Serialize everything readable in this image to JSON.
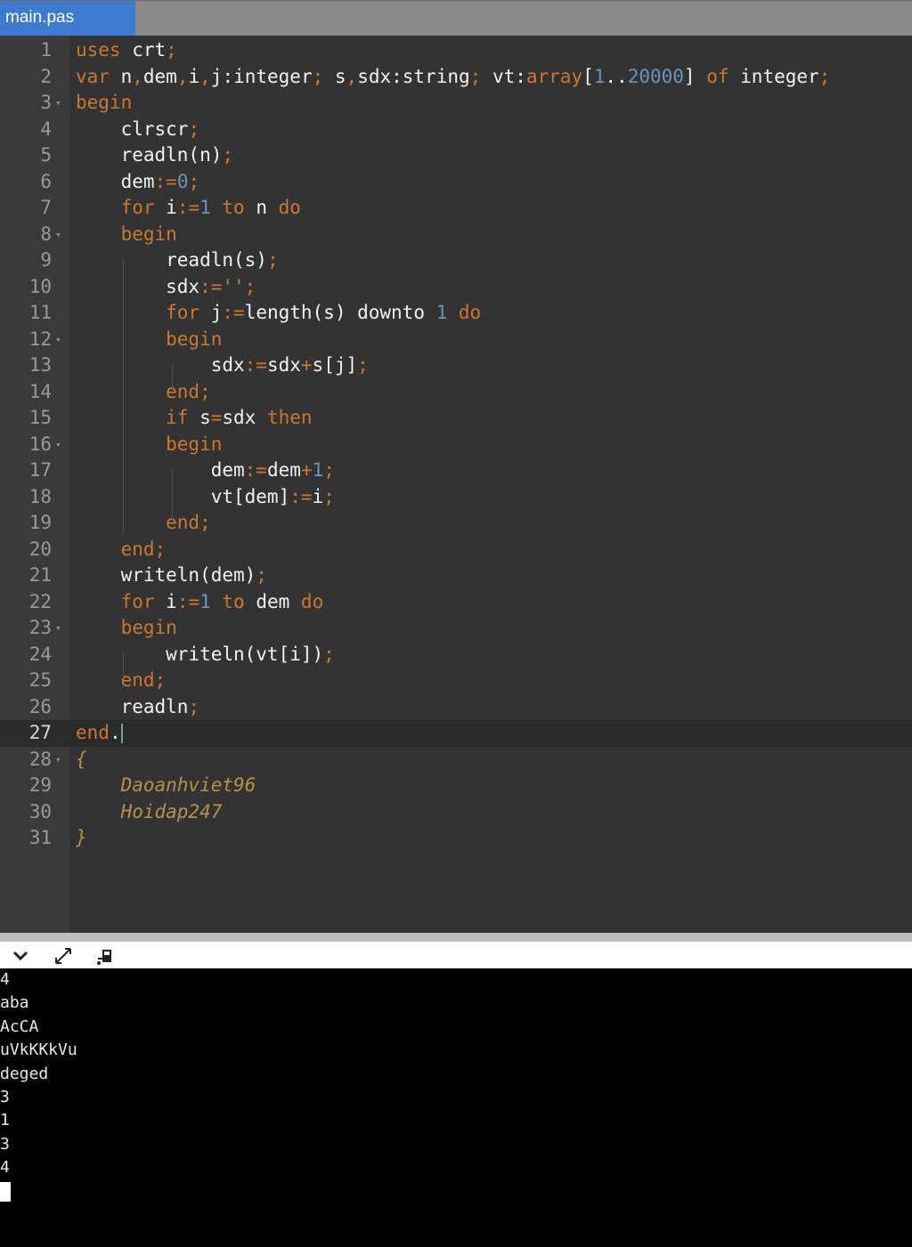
{
  "tab": {
    "title": "main.pas"
  },
  "editor": {
    "lines": [
      {
        "n": "1",
        "t": [
          [
            "k",
            "uses "
          ],
          [
            "",
            "crt"
          ],
          [
            "p",
            ";"
          ]
        ]
      },
      {
        "n": "2",
        "t": [
          [
            "k",
            "var "
          ],
          [
            "",
            "n"
          ],
          [
            "p",
            ","
          ],
          [
            "",
            "dem"
          ],
          [
            "p",
            ","
          ],
          [
            "",
            "i"
          ],
          [
            "p",
            ","
          ],
          [
            "",
            "j:integer"
          ],
          [
            "p",
            "; "
          ],
          [
            "",
            "s"
          ],
          [
            "p",
            ","
          ],
          [
            "",
            "sdx:string"
          ],
          [
            "p",
            "; "
          ],
          [
            "",
            "vt:"
          ],
          [
            "k",
            "array"
          ],
          [
            "",
            "["
          ],
          [
            "n",
            "1"
          ],
          [
            "",
            ".."
          ],
          [
            "n",
            "20000"
          ],
          [
            "",
            "] "
          ],
          [
            "k",
            "of "
          ],
          [
            "",
            "integer"
          ],
          [
            "p",
            ";"
          ]
        ]
      },
      {
        "n": "3",
        "fold": true,
        "t": [
          [
            "k",
            "begin"
          ]
        ]
      },
      {
        "n": "4",
        "t": [
          [
            "",
            "    clrscr"
          ],
          [
            "p",
            ";"
          ]
        ]
      },
      {
        "n": "5",
        "t": [
          [
            "",
            "    readln(n)"
          ],
          [
            "p",
            ";"
          ]
        ]
      },
      {
        "n": "6",
        "t": [
          [
            "",
            "    dem"
          ],
          [
            "p",
            ":="
          ],
          [
            "n",
            "0"
          ],
          [
            "p",
            ";"
          ]
        ]
      },
      {
        "n": "7",
        "t": [
          [
            "k",
            "    for "
          ],
          [
            "",
            "i"
          ],
          [
            "p",
            ":="
          ],
          [
            "n",
            "1"
          ],
          [
            "k",
            " to "
          ],
          [
            "",
            "n "
          ],
          [
            "k",
            "do"
          ]
        ]
      },
      {
        "n": "8",
        "fold": true,
        "t": [
          [
            "k",
            "    begin"
          ]
        ]
      },
      {
        "n": "9",
        "t": [
          [
            "",
            "        readln(s)"
          ],
          [
            "p",
            ";"
          ]
        ]
      },
      {
        "n": "10",
        "t": [
          [
            "",
            "        sdx"
          ],
          [
            "p",
            ":="
          ],
          [
            "s",
            "''"
          ],
          [
            "p",
            ";"
          ]
        ]
      },
      {
        "n": "11",
        "t": [
          [
            "k",
            "        for "
          ],
          [
            "",
            "j"
          ],
          [
            "p",
            ":="
          ],
          [
            "",
            "length(s) downto "
          ],
          [
            "n",
            "1"
          ],
          [
            "k",
            " do"
          ]
        ]
      },
      {
        "n": "12",
        "fold": true,
        "t": [
          [
            "k",
            "        begin"
          ]
        ]
      },
      {
        "n": "13",
        "t": [
          [
            "",
            "            sdx"
          ],
          [
            "p",
            ":="
          ],
          [
            "",
            "sdx"
          ],
          [
            "p",
            "+"
          ],
          [
            "",
            "s[j]"
          ],
          [
            "p",
            ";"
          ]
        ]
      },
      {
        "n": "14",
        "t": [
          [
            "k",
            "        end"
          ],
          [
            "p",
            ";"
          ]
        ]
      },
      {
        "n": "15",
        "t": [
          [
            "k",
            "        if "
          ],
          [
            "",
            "s"
          ],
          [
            "p",
            "="
          ],
          [
            "",
            "sdx "
          ],
          [
            "k",
            "then"
          ]
        ]
      },
      {
        "n": "16",
        "fold": true,
        "t": [
          [
            "k",
            "        begin"
          ]
        ]
      },
      {
        "n": "17",
        "t": [
          [
            "",
            "            dem"
          ],
          [
            "p",
            ":="
          ],
          [
            "",
            "dem"
          ],
          [
            "p",
            "+"
          ],
          [
            "n",
            "1"
          ],
          [
            "p",
            ";"
          ]
        ]
      },
      {
        "n": "18",
        "t": [
          [
            "",
            "            vt[dem]"
          ],
          [
            "p",
            ":="
          ],
          [
            "",
            "i"
          ],
          [
            "p",
            ";"
          ]
        ]
      },
      {
        "n": "19",
        "t": [
          [
            "k",
            "        end"
          ],
          [
            "p",
            ";"
          ]
        ]
      },
      {
        "n": "20",
        "t": [
          [
            "k",
            "    end"
          ],
          [
            "p",
            ";"
          ]
        ]
      },
      {
        "n": "21",
        "t": [
          [
            "",
            "    writeln(dem)"
          ],
          [
            "p",
            ";"
          ]
        ]
      },
      {
        "n": "22",
        "t": [
          [
            "k",
            "    for "
          ],
          [
            "",
            "i"
          ],
          [
            "p",
            ":="
          ],
          [
            "n",
            "1"
          ],
          [
            "k",
            " to "
          ],
          [
            "",
            "dem "
          ],
          [
            "k",
            "do"
          ]
        ]
      },
      {
        "n": "23",
        "fold": true,
        "t": [
          [
            "k",
            "    begin"
          ]
        ]
      },
      {
        "n": "24",
        "t": [
          [
            "",
            "        writeln(vt[i])"
          ],
          [
            "p",
            ";"
          ]
        ]
      },
      {
        "n": "25",
        "t": [
          [
            "k",
            "    end"
          ],
          [
            "p",
            ";"
          ]
        ]
      },
      {
        "n": "26",
        "t": [
          [
            "",
            "    readln"
          ],
          [
            "p",
            ";"
          ]
        ]
      },
      {
        "n": "27",
        "active": true,
        "caret": true,
        "t": [
          [
            "k",
            "end"
          ],
          [
            "",
            "."
          ]
        ]
      },
      {
        "n": "28",
        "fold": true,
        "t": [
          [
            "c",
            "{"
          ]
        ]
      },
      {
        "n": "29",
        "t": [
          [
            "c",
            "    Daoanhviet96"
          ]
        ]
      },
      {
        "n": "30",
        "t": [
          [
            "c",
            "    Hoidap247"
          ]
        ]
      },
      {
        "n": "31",
        "t": [
          [
            "c",
            "}"
          ]
        ]
      }
    ]
  },
  "toolbar": {
    "collapse_icon": "chevron-down-icon",
    "expand_icon": "expand-icon",
    "stop_icon": "stop-icon"
  },
  "console": {
    "lines": [
      "4",
      "aba",
      "AcCA",
      "uVkKKkVu",
      "deged",
      "3",
      "1",
      "3",
      "4"
    ]
  },
  "colors": {
    "keyword": "#cc7832",
    "number": "#6897bb",
    "comment": "#b5924a",
    "tab_active": "#3d7bcf"
  }
}
